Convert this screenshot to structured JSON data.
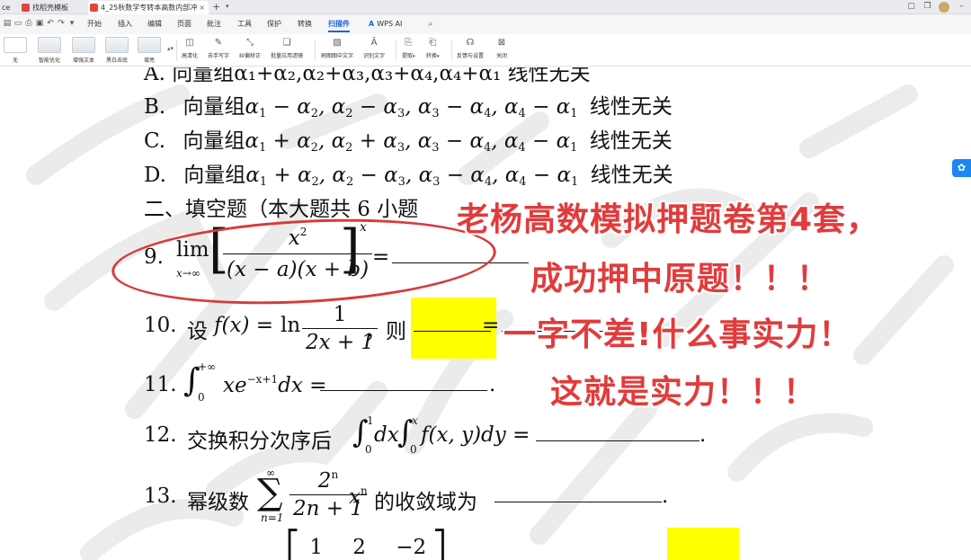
{
  "tabs": [
    {
      "label": "ce",
      "icon": "",
      "active": false
    },
    {
      "label": "找稻壳模板",
      "icon": "docer-icon",
      "active": false
    },
    {
      "label": "4_25秋数学专转本高数内部冲",
      "icon": "pdf-icon",
      "active": true
    }
  ],
  "menu": {
    "items": [
      "开始",
      "插入",
      "编辑",
      "页面",
      "批注",
      "工具",
      "保护",
      "转换",
      "扫描件",
      "WPS AI"
    ],
    "active": "扫描件"
  },
  "ribbon": {
    "styles": [
      "无",
      "智能优化",
      "增强文本",
      "黑白去底",
      "增亮"
    ],
    "tools": [
      "高清化",
      "去手写字",
      "纠偏矫正",
      "批量应用滤镜",
      "刷图图中文字",
      "识别文字",
      "提取",
      "转换",
      "反馈与设置",
      "关闭"
    ]
  },
  "document": {
    "partial_top": "A. 向量组α₁+α₂,α₂+α₃,α₃+α₄,α₄+α₁ 线性无关",
    "option_b": {
      "label": "B.",
      "text": "向量组",
      "tail": "线性无关"
    },
    "option_c": {
      "label": "C.",
      "text": "向量组",
      "tail": "线性无关"
    },
    "option_d": {
      "label": "D.",
      "text": "向量组",
      "tail": "线性无关"
    },
    "section2": "二、填空题（本大题共 6 小题",
    "q9": "9.",
    "q10": {
      "num": "10.",
      "pre": "设",
      "then": "，则"
    },
    "q11": "11.",
    "q12": {
      "num": "12.",
      "pre": "交换积分次序后"
    },
    "q13": {
      "num": "13.",
      "pre": "幂级数",
      "post": "的收敛域为"
    },
    "matrix_row": [
      "1",
      "2",
      "−2"
    ]
  },
  "overlay": {
    "line1": "老杨高数模拟押题卷第4套，",
    "line2": "成功押中原题！！！",
    "line3": "一字不差!什么事实力！",
    "line4": "这就是实力！！！"
  },
  "colors": {
    "accent": "#1c63e6",
    "overlay_red": "#e23b3b",
    "highlight": "#ffff00"
  }
}
